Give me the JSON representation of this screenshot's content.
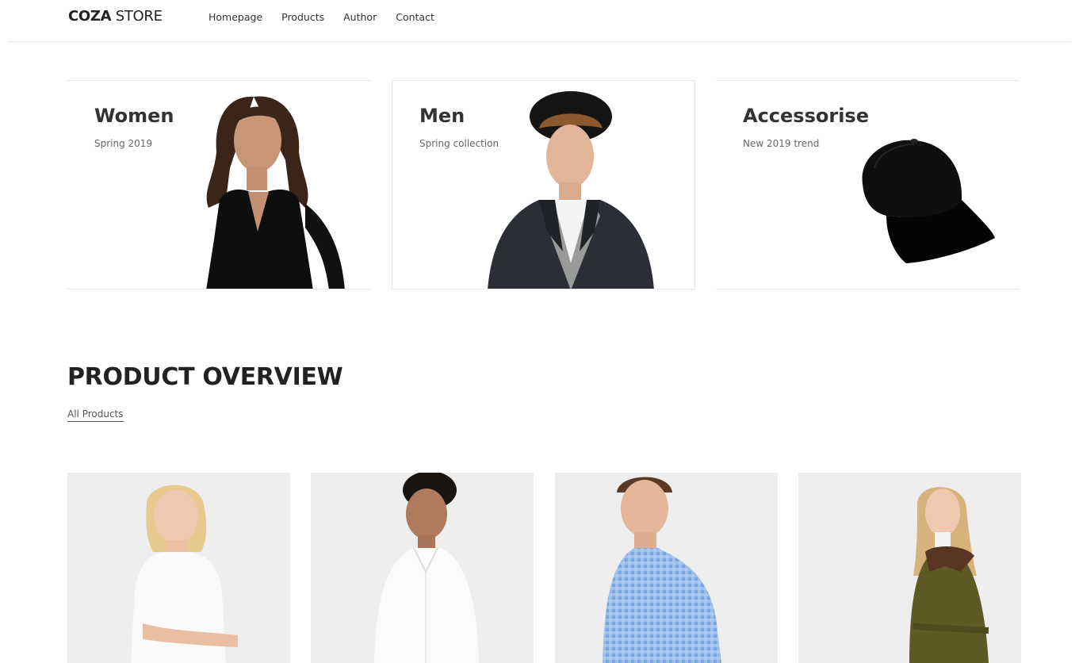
{
  "header": {
    "logo_bold": "COZA",
    "logo_rest": " STORE",
    "nav": [
      {
        "label": "Homepage"
      },
      {
        "label": "Products"
      },
      {
        "label": "Author"
      },
      {
        "label": "Contact"
      }
    ]
  },
  "banners": [
    {
      "title": "Women",
      "subtitle": "Spring 2019"
    },
    {
      "title": "Men",
      "subtitle": "Spring collection"
    },
    {
      "title": "Accessorise",
      "subtitle": "New 2019 trend"
    }
  ],
  "product_overview": {
    "title": "PRODUCT OVERVIEW",
    "filter_label": "All Products"
  },
  "products": [
    {
      "image": "woman-white-tshirt"
    },
    {
      "image": "woman-white-shirt"
    },
    {
      "image": "man-blue-check-shirt"
    },
    {
      "image": "woman-olive-coat"
    }
  ],
  "colors": {
    "text": "#333333",
    "border": "#e6e6e6",
    "product_bg": "#eeeeee"
  }
}
